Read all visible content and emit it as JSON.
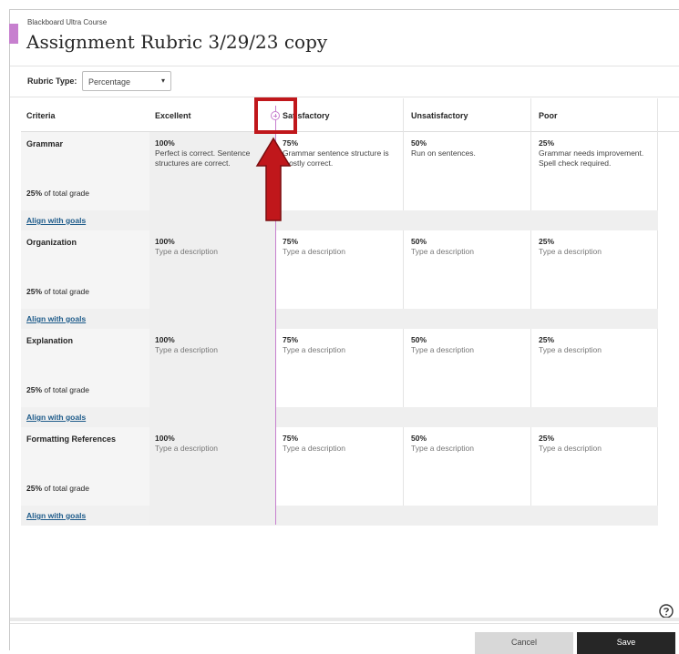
{
  "header": {
    "course_name": "Blackboard Ultra Course",
    "title": "Assignment Rubric 3/29/23 copy"
  },
  "rubric_type": {
    "label": "Rubric Type:",
    "selected": "Percentage"
  },
  "columns": {
    "criteria": "Criteria",
    "levels": [
      "Excellent",
      "Satisfactory",
      "Unsatisfactory",
      "Poor"
    ]
  },
  "rows": [
    {
      "name": "Grammar",
      "weight": "25%",
      "weight_suffix": "of total grade",
      "align_label": "Align with goals",
      "cells": [
        {
          "pct": "100%",
          "desc": "Perfect is correct. Sentence structures are correct."
        },
        {
          "pct": "75%",
          "desc": "Grammar sentence structure is mostly correct."
        },
        {
          "pct": "50%",
          "desc": "Run on sentences."
        },
        {
          "pct": "25%",
          "desc": "Grammar needs improvement. Spell check required."
        }
      ]
    },
    {
      "name": "Organization",
      "weight": "25%",
      "weight_suffix": "of total grade",
      "align_label": "Align with goals",
      "cells": [
        {
          "pct": "100%",
          "desc": "Type a description"
        },
        {
          "pct": "75%",
          "desc": "Type a description"
        },
        {
          "pct": "50%",
          "desc": "Type a description"
        },
        {
          "pct": "25%",
          "desc": "Type a description"
        }
      ]
    },
    {
      "name": "Explanation",
      "weight": "25%",
      "weight_suffix": "of total grade",
      "align_label": "Align with goals",
      "cells": [
        {
          "pct": "100%",
          "desc": "Type a description"
        },
        {
          "pct": "75%",
          "desc": "Type a description"
        },
        {
          "pct": "50%",
          "desc": "Type a description"
        },
        {
          "pct": "25%",
          "desc": "Type a description"
        }
      ]
    },
    {
      "name": "Formatting References",
      "weight": "25%",
      "weight_suffix": "of total grade",
      "align_label": "Align with goals",
      "cells": [
        {
          "pct": "100%",
          "desc": "Type a description"
        },
        {
          "pct": "75%",
          "desc": "Type a description"
        },
        {
          "pct": "50%",
          "desc": "Type a description"
        },
        {
          "pct": "25%",
          "desc": "Type a description"
        }
      ]
    }
  ],
  "footer": {
    "cancel_label": "Cancel",
    "save_label": "Save"
  },
  "colors": {
    "accent": "#c780cf",
    "highlight": "#c0171b",
    "link": "#1e5b8a"
  },
  "icons": [
    "add-column-icon",
    "help-icon",
    "chevron-down-icon",
    "arrow-up-annotation-icon"
  ]
}
